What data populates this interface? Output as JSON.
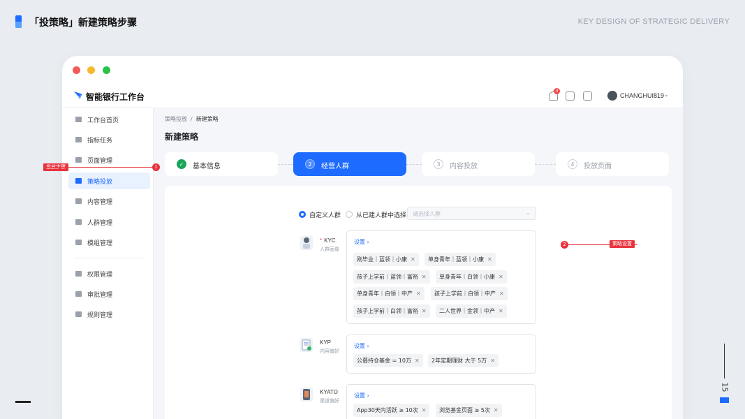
{
  "slide": {
    "title": "「投策略」新建策略步骤",
    "subtitle": "KEY DESIGN OF STRATEGIC DELIVERY",
    "page_number": "15"
  },
  "app": {
    "brand": "智能银行工作台",
    "notification_count": "3",
    "username": "CHANGHUI819"
  },
  "sidebar": {
    "items": [
      {
        "label": "工作台首页",
        "icon": "home-icon"
      },
      {
        "label": "指标任务",
        "icon": "chart-icon"
      },
      {
        "label": "页面管理",
        "icon": "page-icon"
      },
      {
        "label": "策略投放",
        "icon": "strategy-icon",
        "active": true
      },
      {
        "label": "内容管理",
        "icon": "list-icon"
      },
      {
        "label": "人群管理",
        "icon": "people-icon"
      },
      {
        "label": "模组管理",
        "icon": "module-icon"
      },
      {
        "label": "权限管理",
        "icon": "lock-icon"
      },
      {
        "label": "审批管理",
        "icon": "approve-icon"
      },
      {
        "label": "规则管理",
        "icon": "rule-icon"
      }
    ]
  },
  "breadcrumb": {
    "parent": "策略投放",
    "separator": "/",
    "current": "新建策略"
  },
  "page_title": "新建策略",
  "steps": [
    {
      "num": "1",
      "label": "基本信息",
      "state": "done"
    },
    {
      "num": "2",
      "label": "经营人群",
      "state": "active"
    },
    {
      "num": "3",
      "label": "内容投放",
      "state": "pending"
    },
    {
      "num": "4",
      "label": "投放页面",
      "state": "pending"
    }
  ],
  "audience": {
    "option_custom": "自定义人群",
    "option_existing": "从已建人群中选择",
    "select_placeholder": "请选择人群"
  },
  "kyc": {
    "name": "KYC",
    "required": "*",
    "desc": "人群画像",
    "set_label": "设置 ›",
    "chips": [
      "刚毕业｜蓝领｜小康",
      "单身青年｜蓝领｜小康",
      "孩子上学前｜蓝领｜富裕",
      "单身青年｜白领｜小康",
      "单身青年｜白领｜中产",
      "孩子上学前｜白领｜中产",
      "孩子上学前｜白领｜富裕",
      "二人世界｜金领｜中产"
    ]
  },
  "kyp": {
    "name": "KYP",
    "desc": "内容偏好",
    "set_label": "设置 ›",
    "chips": [
      "公募持仓基金 = 10万",
      "2年定期理财 大于 5万"
    ]
  },
  "kyato": {
    "name": "KYATO",
    "desc": "渠道偏好",
    "set_label": "设置 ›",
    "chips": [
      "App30天内活跃 ≥ 10次",
      "浏览基金页面 ≥ 5次"
    ]
  },
  "annotations": [
    {
      "num": "1",
      "label": "投放步骤"
    },
    {
      "num": "2",
      "label": "策略设置"
    }
  ],
  "colors": {
    "accent": "#1e6bff",
    "success": "#1ca55a",
    "annotation": "#e8333d"
  }
}
